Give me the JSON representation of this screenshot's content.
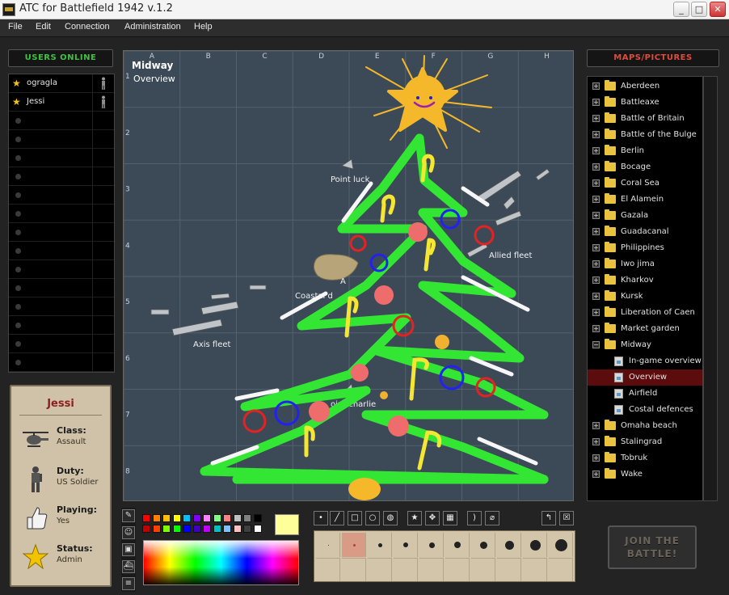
{
  "window": {
    "title": "ATC for Battlefield 1942 v.1.2"
  },
  "menu": [
    "File",
    "Edit",
    "Connection",
    "Administration",
    "Help"
  ],
  "users_panel": {
    "title": "USERS ONLINE",
    "users": [
      {
        "name": "ograglа",
        "empty": false
      },
      {
        "name": "Jessi",
        "empty": false
      }
    ],
    "empty_rows": 14
  },
  "profile": {
    "name": "Jessi",
    "rows": [
      {
        "label": "Class:",
        "value": "Assault",
        "icon": "helicopter-icon"
      },
      {
        "label": "Duty:",
        "value": "US Soldier",
        "icon": "soldier-icon"
      },
      {
        "label": "Playing:",
        "value": "Yes",
        "icon": "thumbs-up-icon"
      },
      {
        "label": "Status:",
        "value": "Admin",
        "icon": "star-icon"
      }
    ]
  },
  "map": {
    "title": "Midway",
    "subtitle": "Overview",
    "columns": [
      "A",
      "B",
      "C",
      "D",
      "E",
      "F",
      "G",
      "H"
    ],
    "rows": [
      "1",
      "2",
      "3",
      "4",
      "5",
      "6",
      "7",
      "8"
    ],
    "labels": {
      "point_luck": "Point luck",
      "allied_fleet": "Allied fleet",
      "coastal": "Coastal d",
      "axis_fleet": "Axis fleet",
      "point_charlie": "oint charlie",
      "island_a": "A"
    }
  },
  "maps_panel": {
    "title": "MAPS/PICTURES",
    "items": [
      {
        "label": "Aberdeen",
        "type": "folder"
      },
      {
        "label": "Battleaxe",
        "type": "folder"
      },
      {
        "label": "Battle of Britain",
        "type": "folder"
      },
      {
        "label": "Battle of the Bulge",
        "type": "folder"
      },
      {
        "label": "Berlin",
        "type": "folder"
      },
      {
        "label": "Bocage",
        "type": "folder"
      },
      {
        "label": "Coral Sea",
        "type": "folder"
      },
      {
        "label": "El Alamein",
        "type": "folder"
      },
      {
        "label": "Gazala",
        "type": "folder"
      },
      {
        "label": "Guadacanal",
        "type": "folder"
      },
      {
        "label": "Philippines",
        "type": "folder"
      },
      {
        "label": "Iwo jima",
        "type": "folder"
      },
      {
        "label": "Kharkov",
        "type": "folder"
      },
      {
        "label": "Kursk",
        "type": "folder"
      },
      {
        "label": "Liberation of Caen",
        "type": "folder"
      },
      {
        "label": "Market garden",
        "type": "folder"
      },
      {
        "label": "Midway",
        "type": "folder-open"
      },
      {
        "label": "In-game overview",
        "type": "picture"
      },
      {
        "label": "Overview",
        "type": "picture",
        "selected": true
      },
      {
        "label": "Airfield",
        "type": "picture"
      },
      {
        "label": "Costal defences",
        "type": "picture"
      },
      {
        "label": "Omaha beach",
        "type": "folder"
      },
      {
        "label": "Stalingrad",
        "type": "folder"
      },
      {
        "label": "Tobruk",
        "type": "folder"
      },
      {
        "label": "Wake",
        "type": "folder"
      }
    ]
  },
  "palette": {
    "row1": [
      "#ff0000",
      "#ff7f00",
      "#ffbf00",
      "#ffff00",
      "#00c0ff",
      "#8000ff",
      "#ff80ff",
      "#80ff80",
      "#ff8080",
      "#c0c0c0",
      "#808080",
      "#000000"
    ],
    "row2": [
      "#c00000",
      "#ff4000",
      "#80ff00",
      "#00ff00",
      "#0000ff",
      "#4000c0",
      "#c000ff",
      "#00c0c0",
      "#80c0ff",
      "#ffc0c0",
      "#404040",
      "#ffffff"
    ],
    "current": "#ffff99"
  },
  "join_button": {
    "label_line1": "JOIN THE",
    "label_line2": "BATTLE!"
  }
}
